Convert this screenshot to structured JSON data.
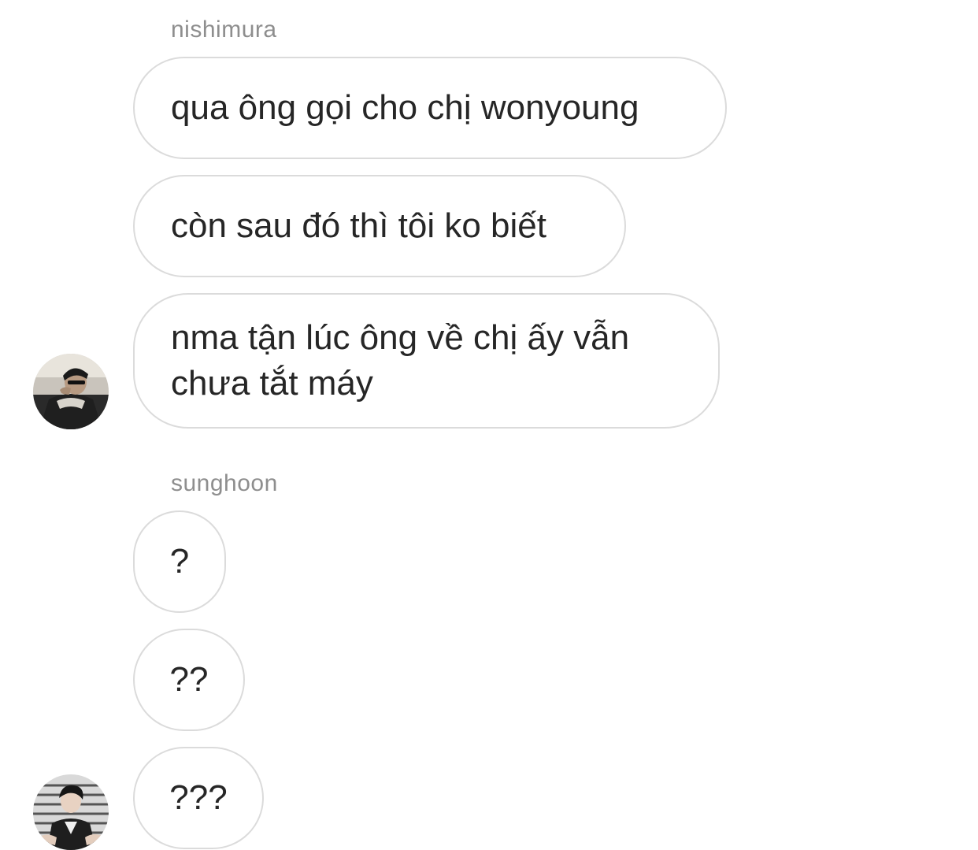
{
  "groups": [
    {
      "sender": "nishimura",
      "messages": [
        "qua ông gọi cho chị wonyoung",
        "còn sau đó thì tôi ko biết",
        "nma tận lúc ông về chị ấy vẫn chưa tắt máy"
      ],
      "avatar_icon": "user-avatar-photo"
    },
    {
      "sender": "sunghoon",
      "messages": [
        "?",
        "??",
        "???"
      ],
      "avatar_icon": "user-avatar-photo"
    }
  ]
}
